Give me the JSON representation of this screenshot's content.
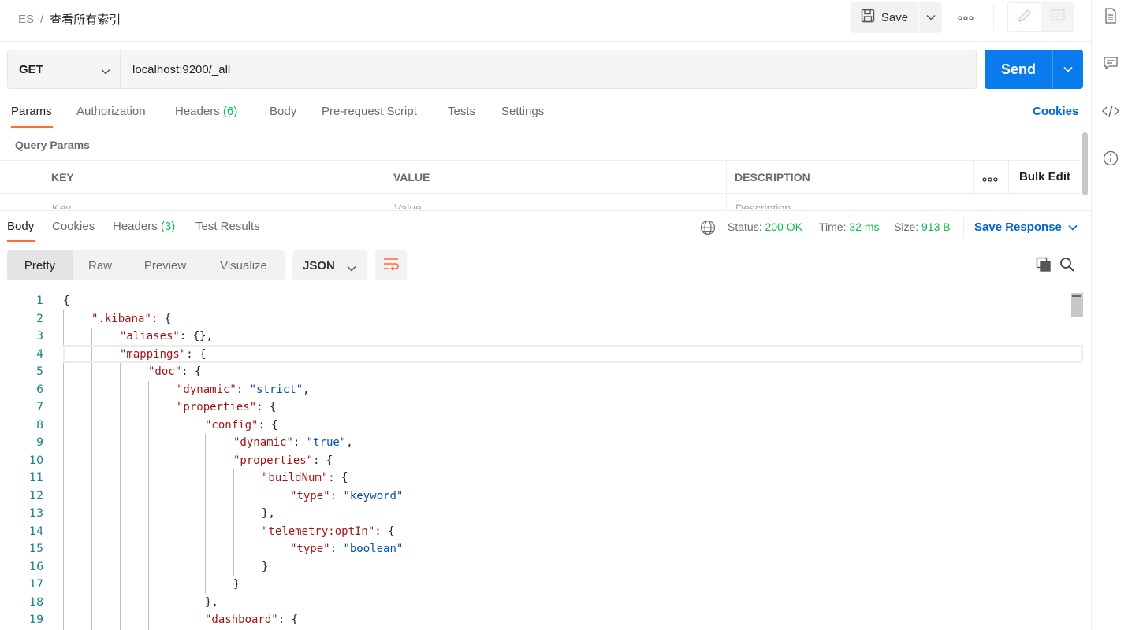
{
  "header": {
    "breadcrumb_parent": "ES",
    "breadcrumb_sep": "/",
    "breadcrumb_current": "查看所有索引",
    "save_label": "Save",
    "more_glyph": "ooo"
  },
  "request": {
    "method": "GET",
    "url": "localhost:9200/_all",
    "send_label": "Send"
  },
  "request_tabs": [
    {
      "label": "Params",
      "count": ""
    },
    {
      "label": "Authorization",
      "count": ""
    },
    {
      "label": "Headers",
      "count": "(6)"
    },
    {
      "label": "Body",
      "count": ""
    },
    {
      "label": "Pre-request Script",
      "count": ""
    },
    {
      "label": "Tests",
      "count": ""
    },
    {
      "label": "Settings",
      "count": ""
    }
  ],
  "cookies_label": "Cookies",
  "query_params": {
    "title": "Query Params",
    "col_key": "KEY",
    "col_value": "VALUE",
    "col_description": "DESCRIPTION",
    "bulk_edit": "Bulk Edit",
    "ph_key": "Key",
    "ph_value": "Value",
    "ph_description": "Description"
  },
  "response_tabs": [
    {
      "label": "Body",
      "count": ""
    },
    {
      "label": "Cookies",
      "count": ""
    },
    {
      "label": "Headers",
      "count": "(3)"
    },
    {
      "label": "Test Results",
      "count": ""
    }
  ],
  "response_meta": {
    "status_label": "Status:",
    "status_value": "200 OK",
    "time_label": "Time:",
    "time_value": "32 ms",
    "size_label": "Size:",
    "size_value": "913 B",
    "save_response": "Save Response"
  },
  "view_modes": [
    "Pretty",
    "Raw",
    "Preview",
    "Visualize"
  ],
  "format": "JSON",
  "code_lines": [
    {
      "n": "1",
      "indent": 0,
      "parts": [
        [
          "p",
          "{"
        ]
      ]
    },
    {
      "n": "2",
      "indent": 1,
      "parts": [
        [
          "k",
          "\".kibana\""
        ],
        [
          "p",
          ": {"
        ]
      ]
    },
    {
      "n": "3",
      "indent": 2,
      "parts": [
        [
          "k",
          "\"aliases\""
        ],
        [
          "p",
          ": {},"
        ]
      ]
    },
    {
      "n": "4",
      "indent": 2,
      "parts": [
        [
          "k",
          "\"mappings\""
        ],
        [
          "p",
          ": {"
        ]
      ]
    },
    {
      "n": "5",
      "indent": 3,
      "parts": [
        [
          "k",
          "\"doc\""
        ],
        [
          "p",
          ": {"
        ]
      ]
    },
    {
      "n": "6",
      "indent": 4,
      "parts": [
        [
          "k",
          "\"dynamic\""
        ],
        [
          "p",
          ": "
        ],
        [
          "s",
          "\"strict\""
        ],
        [
          "p",
          ","
        ]
      ]
    },
    {
      "n": "7",
      "indent": 4,
      "parts": [
        [
          "k",
          "\"properties\""
        ],
        [
          "p",
          ": {"
        ]
      ]
    },
    {
      "n": "8",
      "indent": 5,
      "parts": [
        [
          "k",
          "\"config\""
        ],
        [
          "p",
          ": {"
        ]
      ]
    },
    {
      "n": "9",
      "indent": 6,
      "parts": [
        [
          "k",
          "\"dynamic\""
        ],
        [
          "p",
          ": "
        ],
        [
          "s",
          "\"true\""
        ],
        [
          "p",
          ","
        ]
      ]
    },
    {
      "n": "10",
      "indent": 6,
      "parts": [
        [
          "k",
          "\"properties\""
        ],
        [
          "p",
          ": {"
        ]
      ]
    },
    {
      "n": "11",
      "indent": 7,
      "parts": [
        [
          "k",
          "\"buildNum\""
        ],
        [
          "p",
          ": {"
        ]
      ]
    },
    {
      "n": "12",
      "indent": 8,
      "parts": [
        [
          "k",
          "\"type\""
        ],
        [
          "p",
          ": "
        ],
        [
          "s",
          "\"keyword\""
        ]
      ]
    },
    {
      "n": "13",
      "indent": 7,
      "parts": [
        [
          "p",
          "},"
        ]
      ]
    },
    {
      "n": "14",
      "indent": 7,
      "parts": [
        [
          "k",
          "\"telemetry:optIn\""
        ],
        [
          "p",
          ": {"
        ]
      ]
    },
    {
      "n": "15",
      "indent": 8,
      "parts": [
        [
          "k",
          "\"type\""
        ],
        [
          "p",
          ": "
        ],
        [
          "s",
          "\"boolean\""
        ]
      ]
    },
    {
      "n": "16",
      "indent": 7,
      "parts": [
        [
          "p",
          "}"
        ]
      ]
    },
    {
      "n": "17",
      "indent": 6,
      "parts": [
        [
          "p",
          "}"
        ]
      ]
    },
    {
      "n": "18",
      "indent": 5,
      "parts": [
        [
          "p",
          "},"
        ]
      ]
    },
    {
      "n": "19",
      "indent": 5,
      "parts": [
        [
          "k",
          "\"dashboard\""
        ],
        [
          "p",
          ": {"
        ]
      ]
    }
  ],
  "colors": {
    "accent_orange": "#ff6c37",
    "send_blue": "#097bed",
    "link_blue": "#0265d2",
    "status_green": "#0cbb52",
    "json_key": "#a31515",
    "json_string": "#0451a5",
    "line_number": "#167e85"
  },
  "icons": {
    "save": "floppy-disk-icon",
    "documentation": "document-icon",
    "comments": "comment-icon",
    "code": "code-icon",
    "info": "info-icon",
    "globe": "globe-icon",
    "copy": "copy-icon",
    "search": "search-icon",
    "wrap": "wrap-lines-icon",
    "edit": "pencil-icon"
  }
}
